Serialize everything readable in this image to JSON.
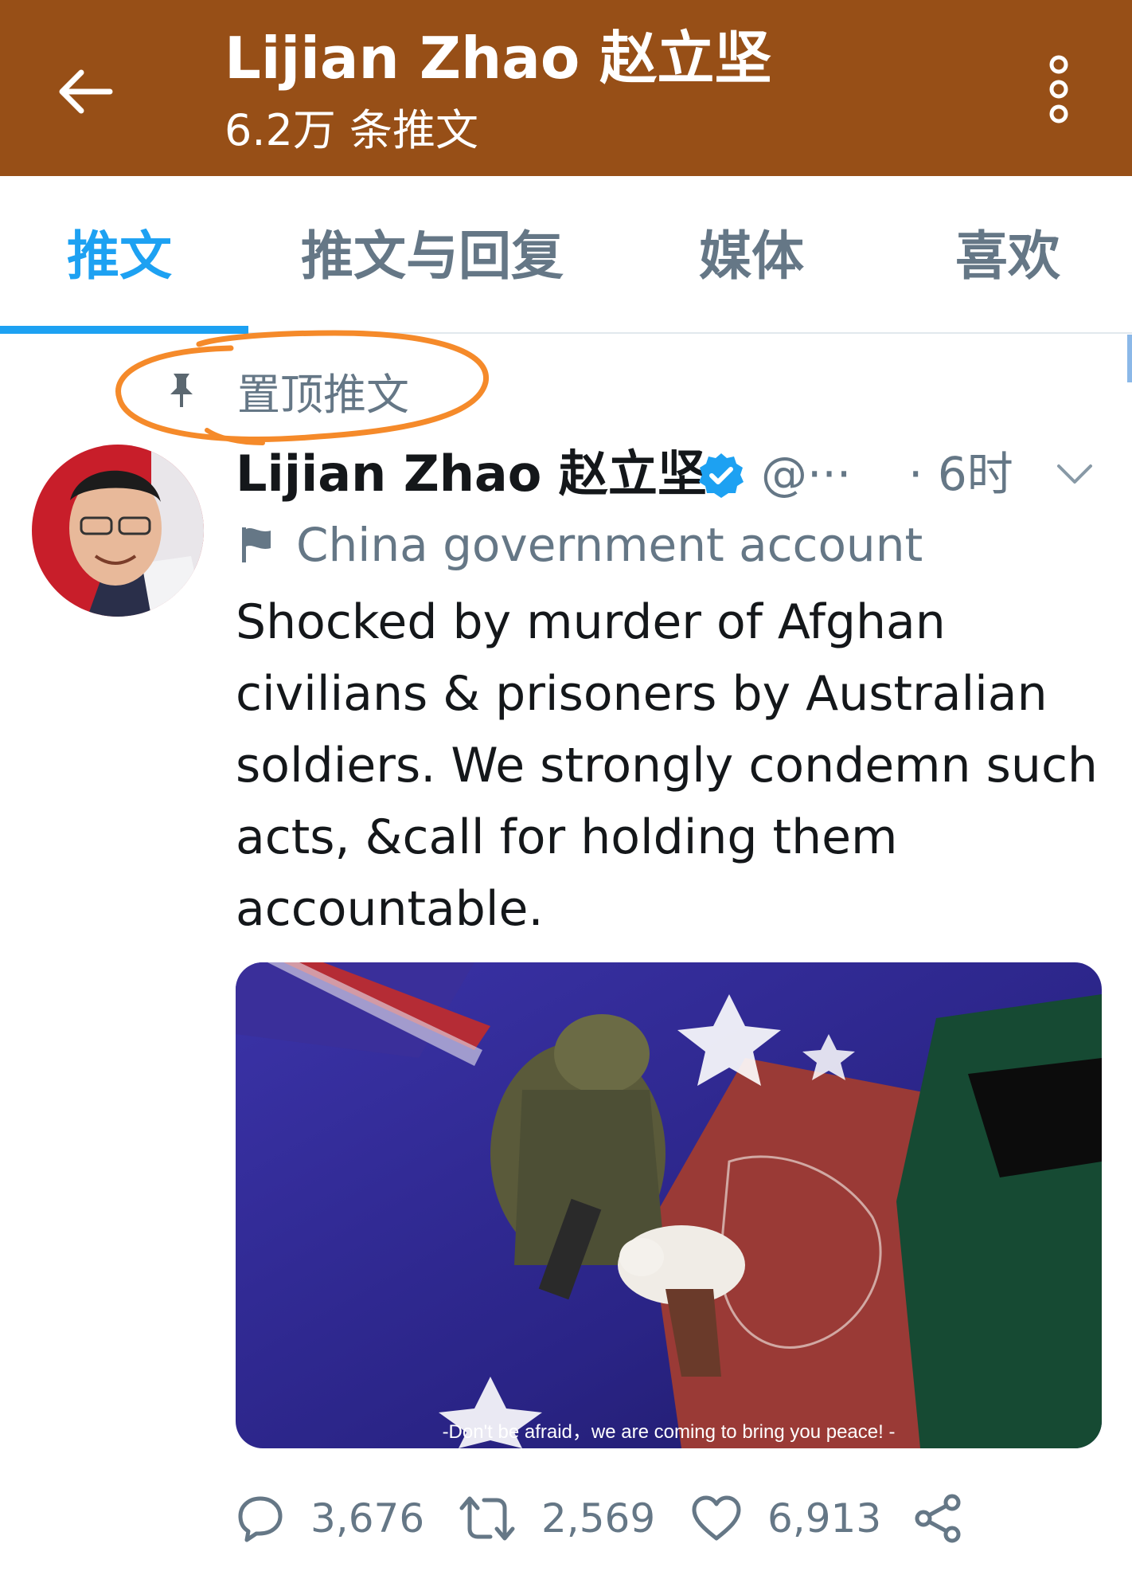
{
  "colors": {
    "header_bg": "#974f17",
    "accent": "#1da1f2",
    "muted": "#657786",
    "annotation": "#f58a2a"
  },
  "header": {
    "title": "Lijian Zhao 赵立坚",
    "subtitle": "6.2万 条推文",
    "back_icon": "arrow-left-icon",
    "more_icon": "more-vertical-icon"
  },
  "tabs": [
    {
      "label": "推文",
      "active": true
    },
    {
      "label": "推文与回复",
      "active": false
    },
    {
      "label": "媒体",
      "active": false
    },
    {
      "label": "喜欢",
      "active": false
    }
  ],
  "tweet": {
    "pinned_label": "置顶推文",
    "author_name": "Lijian Zhao 赵立坚",
    "handle": "@···",
    "time": "· 6时",
    "account_label": "China government account",
    "text": "Shocked by murder of Afghan civilians & prisoners by Australian soldiers. We strongly condemn such acts, &call for holding them accountable.",
    "media_caption": "-Don't be afraid，we are coming to bring you peace! -",
    "stats": {
      "replies": "3,676",
      "retweets": "2,569",
      "likes": "6,913"
    }
  }
}
